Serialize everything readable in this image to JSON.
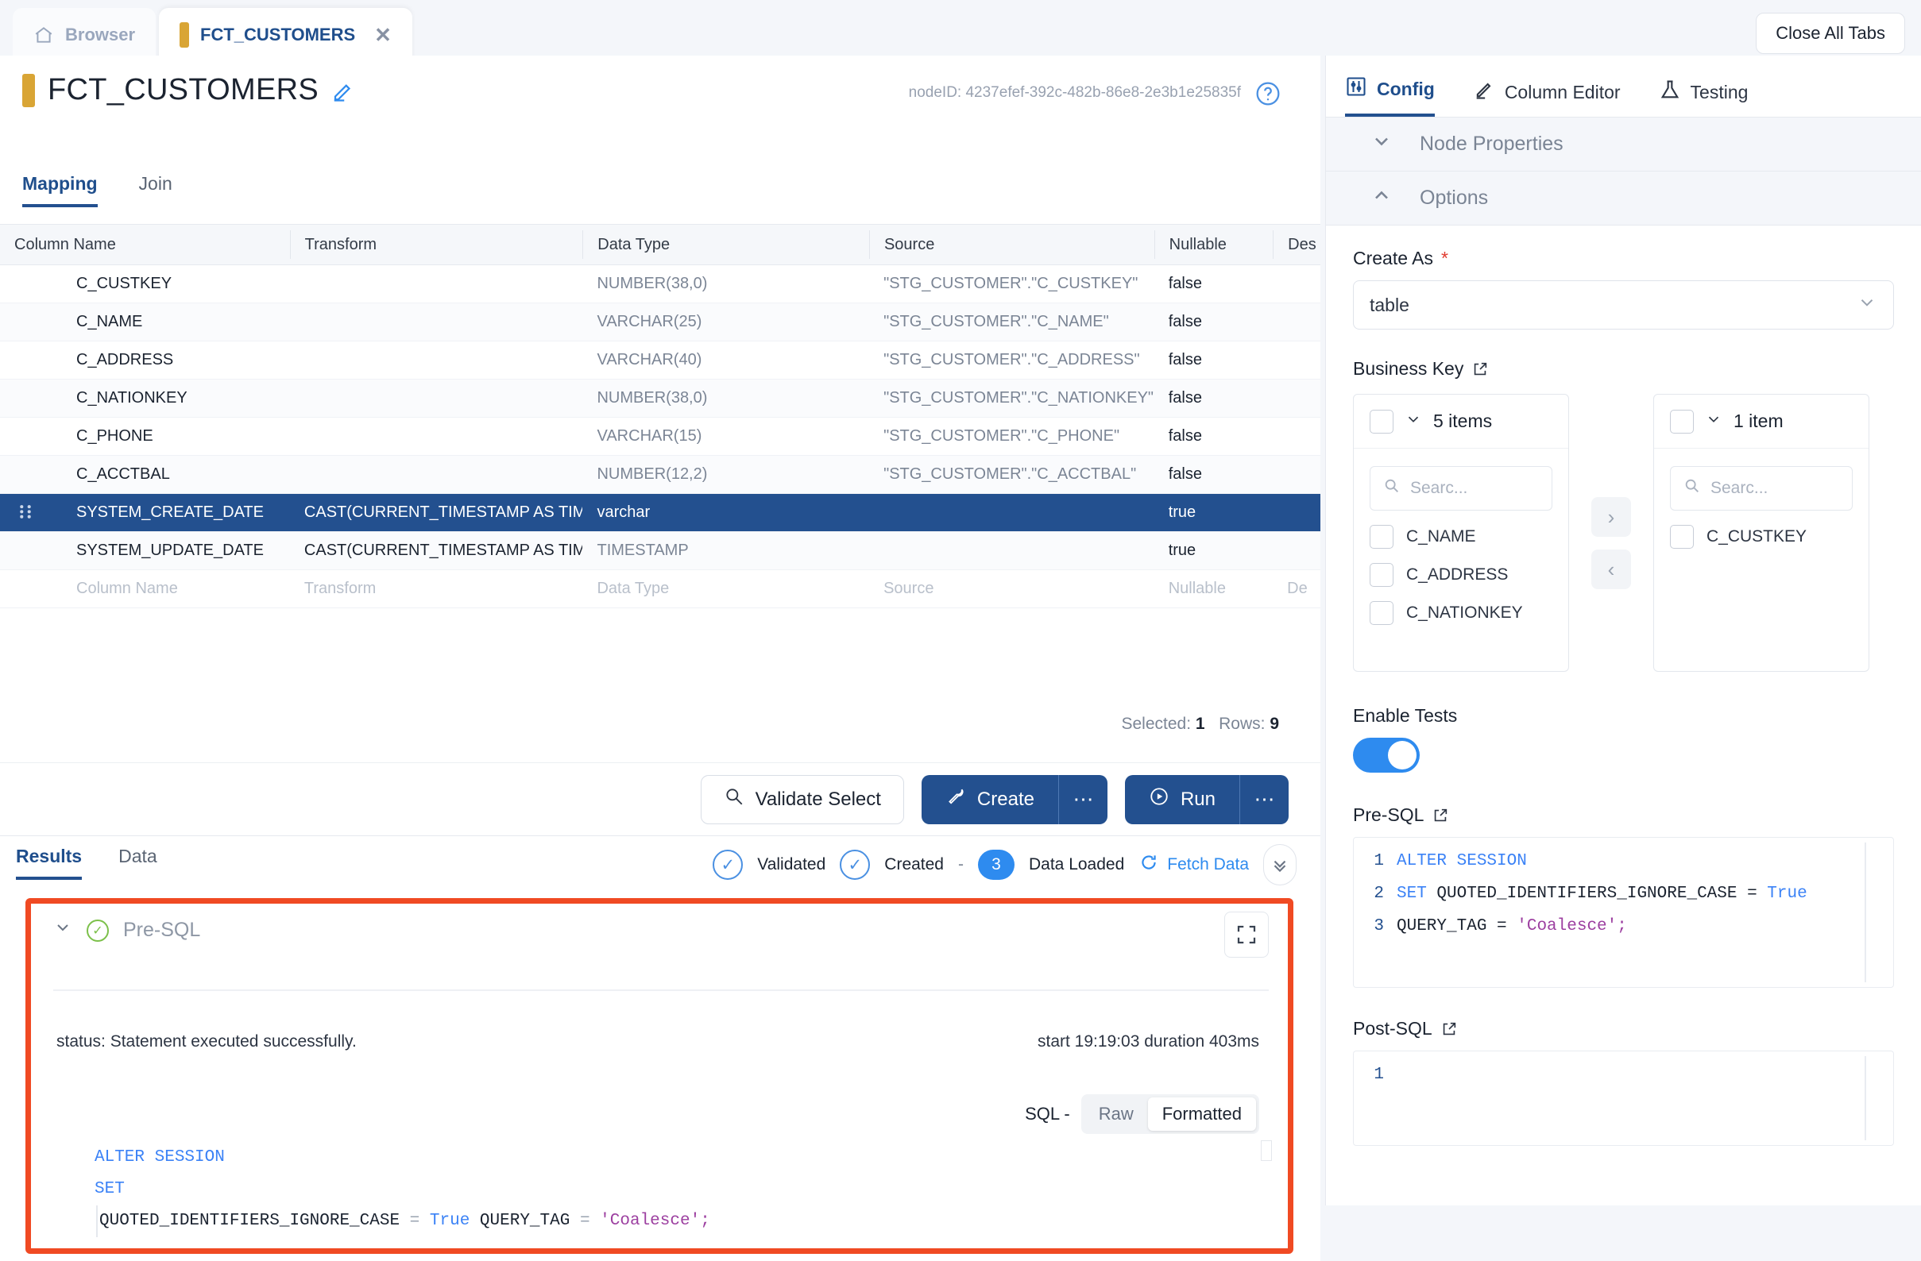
{
  "tabs": {
    "browser_label": "Browser",
    "active_label": "FCT_CUSTOMERS",
    "close_all_label": "Close All Tabs"
  },
  "header": {
    "title": "FCT_CUSTOMERS",
    "node_id": "nodeID: 4237efef-392c-482b-86e8-2e3b1e25835f"
  },
  "subtabs": [
    {
      "label": "Mapping"
    },
    {
      "label": "Join"
    }
  ],
  "grid": {
    "columns": [
      "Column Name",
      "Transform",
      "Data Type",
      "Source",
      "Nullable",
      "Des"
    ],
    "rows": [
      {
        "name": "C_CUSTKEY",
        "transform": "",
        "datatype": "NUMBER(38,0)",
        "source": "\"STG_CUSTOMER\".\"C_CUSTKEY\"",
        "nullable": "false"
      },
      {
        "name": "C_NAME",
        "transform": "",
        "datatype": "VARCHAR(25)",
        "source": "\"STG_CUSTOMER\".\"C_NAME\"",
        "nullable": "false"
      },
      {
        "name": "C_ADDRESS",
        "transform": "",
        "datatype": "VARCHAR(40)",
        "source": "\"STG_CUSTOMER\".\"C_ADDRESS\"",
        "nullable": "false"
      },
      {
        "name": "C_NATIONKEY",
        "transform": "",
        "datatype": "NUMBER(38,0)",
        "source": "\"STG_CUSTOMER\".\"C_NATIONKEY\"",
        "nullable": "false"
      },
      {
        "name": "C_PHONE",
        "transform": "",
        "datatype": "VARCHAR(15)",
        "source": "\"STG_CUSTOMER\".\"C_PHONE\"",
        "nullable": "false"
      },
      {
        "name": "C_ACCTBAL",
        "transform": "",
        "datatype": "NUMBER(12,2)",
        "source": "\"STG_CUSTOMER\".\"C_ACCTBAL\"",
        "nullable": "false"
      },
      {
        "name": "SYSTEM_CREATE_DATE",
        "transform": "CAST(CURRENT_TIMESTAMP AS TIM",
        "datatype": "varchar",
        "source": "",
        "nullable": "true"
      },
      {
        "name": "SYSTEM_UPDATE_DATE",
        "transform": "CAST(CURRENT_TIMESTAMP AS TIM",
        "datatype": "TIMESTAMP",
        "source": "",
        "nullable": "true"
      }
    ],
    "selected_row_index": 6,
    "placeholder_row": {
      "name": "Column Name",
      "transform": "Transform",
      "datatype": "Data Type",
      "source": "Source",
      "nullable": "Nullable",
      "desc": "De"
    },
    "selected_label": "Selected:",
    "selected_count": "1",
    "rows_label": "Rows:",
    "rows_count": "9"
  },
  "actions": {
    "validate_label": "Validate Select",
    "create_label": "Create",
    "run_label": "Run",
    "more_label": "⋯"
  },
  "results": {
    "tabs": [
      {
        "label": "Results"
      },
      {
        "label": "Data"
      }
    ],
    "status": {
      "validated": "Validated",
      "created": "Created",
      "dash": "-",
      "data_loaded_count": "3",
      "data_loaded": "Data Loaded",
      "fetch_data": "Fetch Data"
    },
    "panel": {
      "title": "Pre-SQL",
      "status_text": "status: Statement executed successfully.",
      "timing_text": "start 19:19:03 duration 403ms",
      "sql_label": "SQL -",
      "toggle_raw": "Raw",
      "toggle_formatted": "Formatted",
      "code": {
        "line1": "ALTER SESSION",
        "line2": "SET",
        "line3_a": "QUOTED_IDENTIFIERS_IGNORE_CASE",
        "line3_eq1": "=",
        "line3_true": "True",
        "line3_b": "QUERY_TAG",
        "line3_eq2": "=",
        "line3_str": "'Coalesce';"
      }
    },
    "highlight_color": "#f04a23"
  },
  "config": {
    "tabs": [
      {
        "label": "Config"
      },
      {
        "label": "Column Editor"
      },
      {
        "label": "Testing"
      }
    ],
    "accordions": [
      {
        "label": "Node Properties",
        "state": "collapsed"
      },
      {
        "label": "Options",
        "state": "expanded"
      }
    ],
    "create_as": {
      "label": "Create As",
      "value": "table",
      "required": "*"
    },
    "business_key": {
      "label": "Business Key",
      "left": {
        "header": "5 items",
        "search_placeholder": "Searc...",
        "items": [
          "C_NAME",
          "C_ADDRESS",
          "C_NATIONKEY"
        ]
      },
      "right": {
        "header": "1 item",
        "search_placeholder": "Searc...",
        "items": [
          "C_CUSTKEY"
        ]
      },
      "move_right": "›",
      "move_left": "‹"
    },
    "enable_tests": {
      "label": "Enable Tests",
      "value": "on"
    },
    "pre_sql": {
      "label": "Pre-SQL",
      "lines": [
        {
          "no": "1",
          "kw": "ALTER SESSION",
          "rest": ""
        },
        {
          "no": "2",
          "kw": "SET",
          "rest": " QUOTED_IDENTIFIERS_IGNORE_CASE = True"
        },
        {
          "no": "3",
          "kw": "",
          "rest": "QUERY_TAG = 'Coalesce';"
        }
      ]
    },
    "post_sql": {
      "label": "Post-SQL",
      "lines": [
        {
          "no": "1",
          "text": ""
        }
      ]
    }
  },
  "colors": {
    "accent": "#23508f",
    "link": "#2e8bef",
    "amber": "#d9a535",
    "alert": "#f04a23"
  }
}
